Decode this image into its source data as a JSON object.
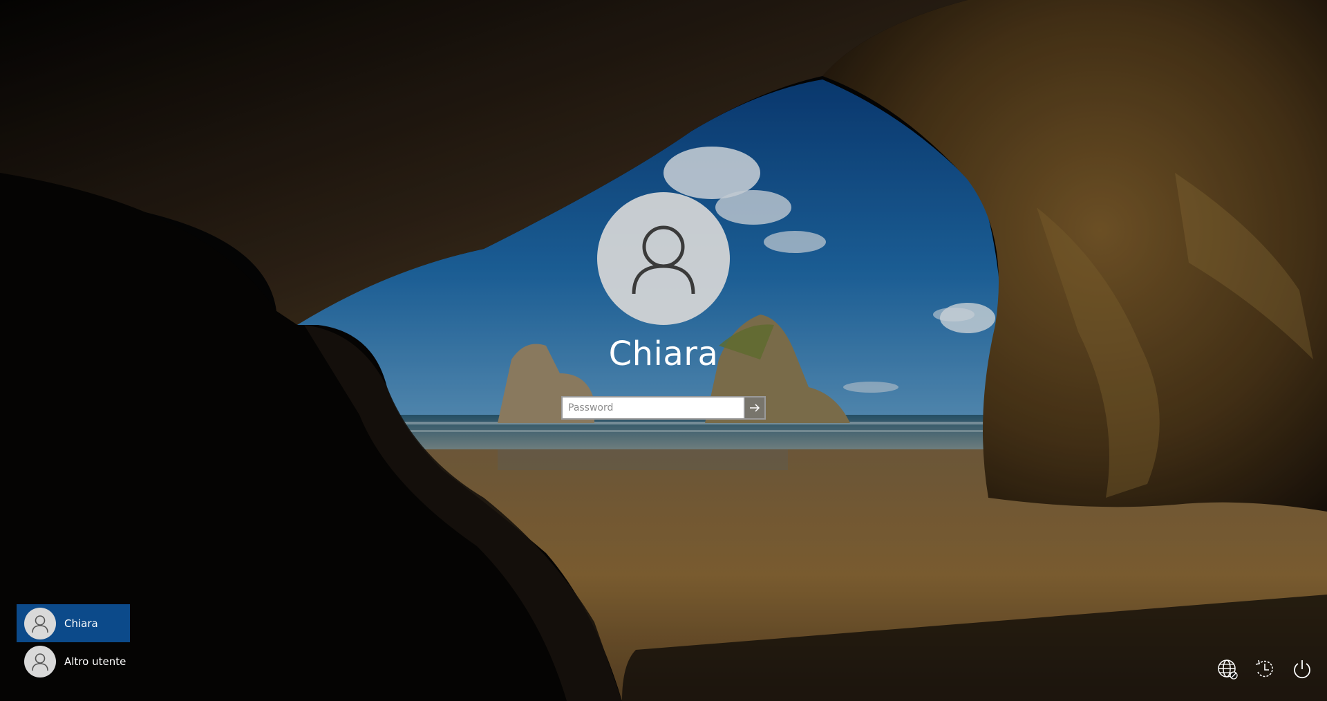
{
  "user": {
    "name": "Chiara"
  },
  "password": {
    "placeholder": "Password",
    "value": ""
  },
  "user_list": [
    {
      "label": "Chiara",
      "selected": true
    },
    {
      "label": "Altro utente",
      "selected": false
    }
  ],
  "tray": {
    "icons": [
      "network-icon",
      "accessibility-icon",
      "power-icon"
    ]
  },
  "colors": {
    "selected_user_bg": "#0c4a8a",
    "avatar_bg": "#d7d7d7",
    "text": "#ffffff"
  }
}
